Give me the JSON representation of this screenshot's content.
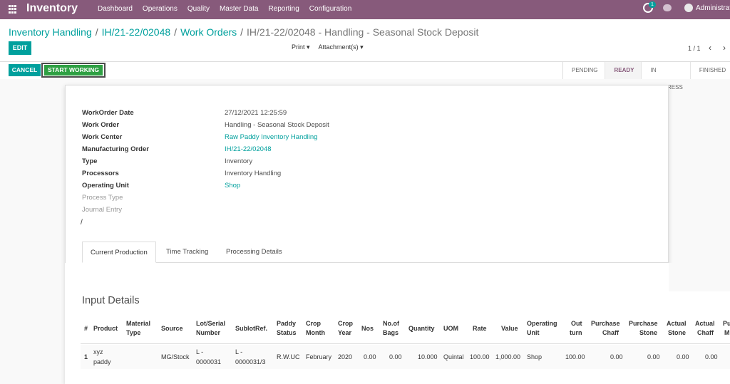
{
  "navbar": {
    "brand": "Inventory",
    "menu": [
      "Dashboard",
      "Operations",
      "Quality",
      "Master Data",
      "Reporting",
      "Configuration"
    ],
    "activity_count": "1",
    "user": "Administrator"
  },
  "breadcrumb": {
    "items": [
      "Inventory Handling",
      "IH/21-22/02048",
      "Work Orders"
    ],
    "current": "IH/21-22/02048 - Handling - Seasonal Stock Deposit"
  },
  "toolbar": {
    "edit_label": "EDIT",
    "print_label": "Print ▾",
    "attachments_label": "Attachment(s) ▾",
    "pager": "1 / 1",
    "prev_icon": "‹",
    "next_icon": "›"
  },
  "statusbar": {
    "cancel_label": "CANCEL",
    "start_label": "START WORKING",
    "stages": [
      "PENDING",
      "READY",
      "IN PROGRESS",
      "FINISHED"
    ],
    "active_stage": "READY"
  },
  "form": {
    "fields": [
      {
        "label": "WorkOrder Date",
        "value": "27/12/2021 12:25:59"
      },
      {
        "label": "Work Order",
        "value": "Handling - Seasonal Stock Deposit"
      },
      {
        "label": "Work Center",
        "value": "Raw Paddy Inventory Handling"
      },
      {
        "label": "Manufacturing Order",
        "value": "IH/21-22/02048"
      },
      {
        "label": "Type",
        "value": "Inventory"
      },
      {
        "label": "Processors",
        "value": "Inventory Handling"
      },
      {
        "label": "Operating Unit",
        "value": "Shop"
      },
      {
        "label": "Process Type",
        "value": ""
      },
      {
        "label": "Journal Entry",
        "value": ""
      }
    ],
    "slash": "/"
  },
  "tabs": [
    "Current Production",
    "Time Tracking",
    "Processing Details"
  ],
  "input_details": {
    "title": "Input Details",
    "headers": [
      [
        "#"
      ],
      [
        "Product"
      ],
      [
        "Material",
        "Type"
      ],
      [
        "Source"
      ],
      [
        "Lot/Serial",
        "Number"
      ],
      [
        "SublotRef."
      ],
      [
        "Paddy",
        "Status"
      ],
      [
        "Crop",
        "Month"
      ],
      [
        "Crop",
        "Year"
      ],
      [
        "Nos"
      ],
      [
        "No.of",
        "Bags"
      ],
      [
        "Quantity"
      ],
      [
        "UOM"
      ],
      [
        "Rate"
      ],
      [
        "Value"
      ],
      [
        "Operating",
        "Unit"
      ],
      [
        "Out",
        "turn"
      ],
      [
        "Purchase",
        "Chaff"
      ],
      [
        "Purchase",
        "Stone"
      ],
      [
        "Actual",
        "Stone"
      ],
      [
        "Actual",
        "Chaff"
      ],
      [
        "Pu",
        "M"
      ]
    ],
    "rows": [
      {
        "num": "1",
        "product": [
          "xyz",
          "paddy"
        ],
        "material_type": "",
        "source": "MG/Stock",
        "lot": [
          "L -",
          "0000031"
        ],
        "sublot": [
          "L -",
          "0000031/3"
        ],
        "paddy_status": "R.W.UC",
        "crop_month": "February",
        "crop_year": "2020",
        "nos": "0.00",
        "bags": "0.00",
        "quantity": "10.000",
        "uom": "Quintal",
        "rate": "100.00",
        "value": "1,000.00",
        "operating_unit": "Shop",
        "outturn": "100.00",
        "purchase_chaff": "0.00",
        "purchase_stone": "0.00",
        "actual_stone": "0.00",
        "actual_chaff": "0.00"
      }
    ]
  },
  "colors": {
    "navbar": "#875a7b",
    "primary": "#00a09d",
    "start_button": "#2ea043"
  }
}
